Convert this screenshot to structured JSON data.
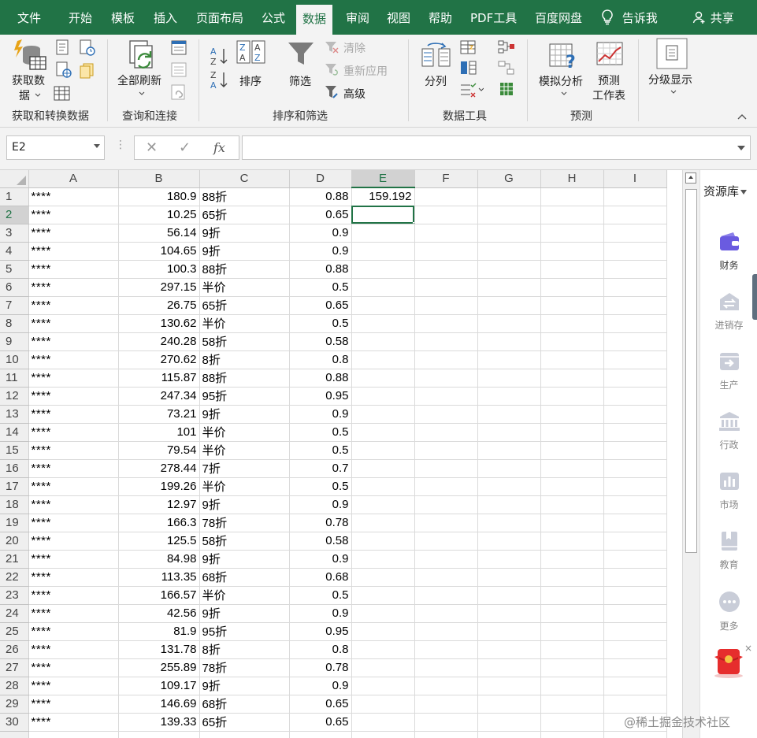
{
  "tabs": {
    "file": "文件",
    "home": "开始",
    "template": "模板",
    "insert": "插入",
    "layout": "页面布局",
    "formula": "公式",
    "data": "数据",
    "review": "审阅",
    "view": "视图",
    "help": "帮助",
    "pdf": "PDF工具",
    "baidu": "百度网盘",
    "tellme": "告诉我",
    "share": "共享"
  },
  "ribbon": {
    "get_data_1": "获取数",
    "get_data_2": "据",
    "refresh_all": "全部刷新",
    "sort": "排序",
    "filter": "筛选",
    "clear": "清除",
    "reapply": "重新应用",
    "advanced": "高级",
    "text_to_columns": "分列",
    "what_if": "模拟分析",
    "forecast_1": "预测",
    "forecast_2": "工作表",
    "outline": "分级显示",
    "group_get_transform": "获取和转换数据",
    "group_query": "查询和连接",
    "group_sort_filter": "排序和筛选",
    "group_data_tools": "数据工具",
    "group_forecast": "预测"
  },
  "formula_bar": {
    "name_box": "E2",
    "formula": ""
  },
  "sheet": {
    "columns": [
      "A",
      "B",
      "C",
      "D",
      "E",
      "F",
      "G",
      "H",
      "I"
    ],
    "selected_cell": "E2",
    "rows": [
      {
        "n": "1",
        "a": "****",
        "b": "180.9",
        "c": "88折",
        "d": "0.88",
        "e": "159.192"
      },
      {
        "n": "2",
        "a": "****",
        "b": "10.25",
        "c": "65折",
        "d": "0.65",
        "e": ""
      },
      {
        "n": "3",
        "a": "****",
        "b": "56.14",
        "c": "9折",
        "d": "0.9",
        "e": ""
      },
      {
        "n": "4",
        "a": "****",
        "b": "104.65",
        "c": "9折",
        "d": "0.9",
        "e": ""
      },
      {
        "n": "5",
        "a": "****",
        "b": "100.3",
        "c": "88折",
        "d": "0.88",
        "e": ""
      },
      {
        "n": "6",
        "a": "****",
        "b": "297.15",
        "c": "半价",
        "d": "0.5",
        "e": ""
      },
      {
        "n": "7",
        "a": "****",
        "b": "26.75",
        "c": "65折",
        "d": "0.65",
        "e": ""
      },
      {
        "n": "8",
        "a": "****",
        "b": "130.62",
        "c": "半价",
        "d": "0.5",
        "e": ""
      },
      {
        "n": "9",
        "a": "****",
        "b": "240.28",
        "c": "58折",
        "d": "0.58",
        "e": ""
      },
      {
        "n": "10",
        "a": "****",
        "b": "270.62",
        "c": "8折",
        "d": "0.8",
        "e": ""
      },
      {
        "n": "11",
        "a": "****",
        "b": "115.87",
        "c": "88折",
        "d": "0.88",
        "e": ""
      },
      {
        "n": "12",
        "a": "****",
        "b": "247.34",
        "c": "95折",
        "d": "0.95",
        "e": ""
      },
      {
        "n": "13",
        "a": "****",
        "b": "73.21",
        "c": "9折",
        "d": "0.9",
        "e": ""
      },
      {
        "n": "14",
        "a": "****",
        "b": "101",
        "c": "半价",
        "d": "0.5",
        "e": ""
      },
      {
        "n": "15",
        "a": "****",
        "b": "79.54",
        "c": "半价",
        "d": "0.5",
        "e": ""
      },
      {
        "n": "16",
        "a": "****",
        "b": "278.44",
        "c": "7折",
        "d": "0.7",
        "e": ""
      },
      {
        "n": "17",
        "a": "****",
        "b": "199.26",
        "c": "半价",
        "d": "0.5",
        "e": ""
      },
      {
        "n": "18",
        "a": "****",
        "b": "12.97",
        "c": "9折",
        "d": "0.9",
        "e": ""
      },
      {
        "n": "19",
        "a": "****",
        "b": "166.3",
        "c": "78折",
        "d": "0.78",
        "e": ""
      },
      {
        "n": "20",
        "a": "****",
        "b": "125.5",
        "c": "58折",
        "d": "0.58",
        "e": ""
      },
      {
        "n": "21",
        "a": "****",
        "b": "84.98",
        "c": "9折",
        "d": "0.9",
        "e": ""
      },
      {
        "n": "22",
        "a": "****",
        "b": "113.35",
        "c": "68折",
        "d": "0.68",
        "e": ""
      },
      {
        "n": "23",
        "a": "****",
        "b": "166.57",
        "c": "半价",
        "d": "0.5",
        "e": ""
      },
      {
        "n": "24",
        "a": "****",
        "b": "42.56",
        "c": "9折",
        "d": "0.9",
        "e": ""
      },
      {
        "n": "25",
        "a": "****",
        "b": "81.9",
        "c": "95折",
        "d": "0.95",
        "e": ""
      },
      {
        "n": "26",
        "a": "****",
        "b": "131.78",
        "c": "8折",
        "d": "0.8",
        "e": ""
      },
      {
        "n": "27",
        "a": "****",
        "b": "255.89",
        "c": "78折",
        "d": "0.78",
        "e": ""
      },
      {
        "n": "28",
        "a": "****",
        "b": "109.17",
        "c": "9折",
        "d": "0.9",
        "e": ""
      },
      {
        "n": "29",
        "a": "****",
        "b": "146.69",
        "c": "68折",
        "d": "0.65",
        "e": ""
      },
      {
        "n": "30",
        "a": "****",
        "b": "139.33",
        "c": "65折",
        "d": "0.65",
        "e": ""
      }
    ]
  },
  "right_panel": {
    "title": "资源库",
    "items": [
      "财务",
      "进销存",
      "生产",
      "行政",
      "市场",
      "教育",
      "更多"
    ]
  },
  "watermark": "@稀土掘金技术社区",
  "colors": {
    "accent": "#217346",
    "tab_bg": "#217346",
    "ribbon_bg": "#f3f3f3",
    "panel_icon": "#c9cdd8",
    "finance_icon": "#6a5be0"
  }
}
